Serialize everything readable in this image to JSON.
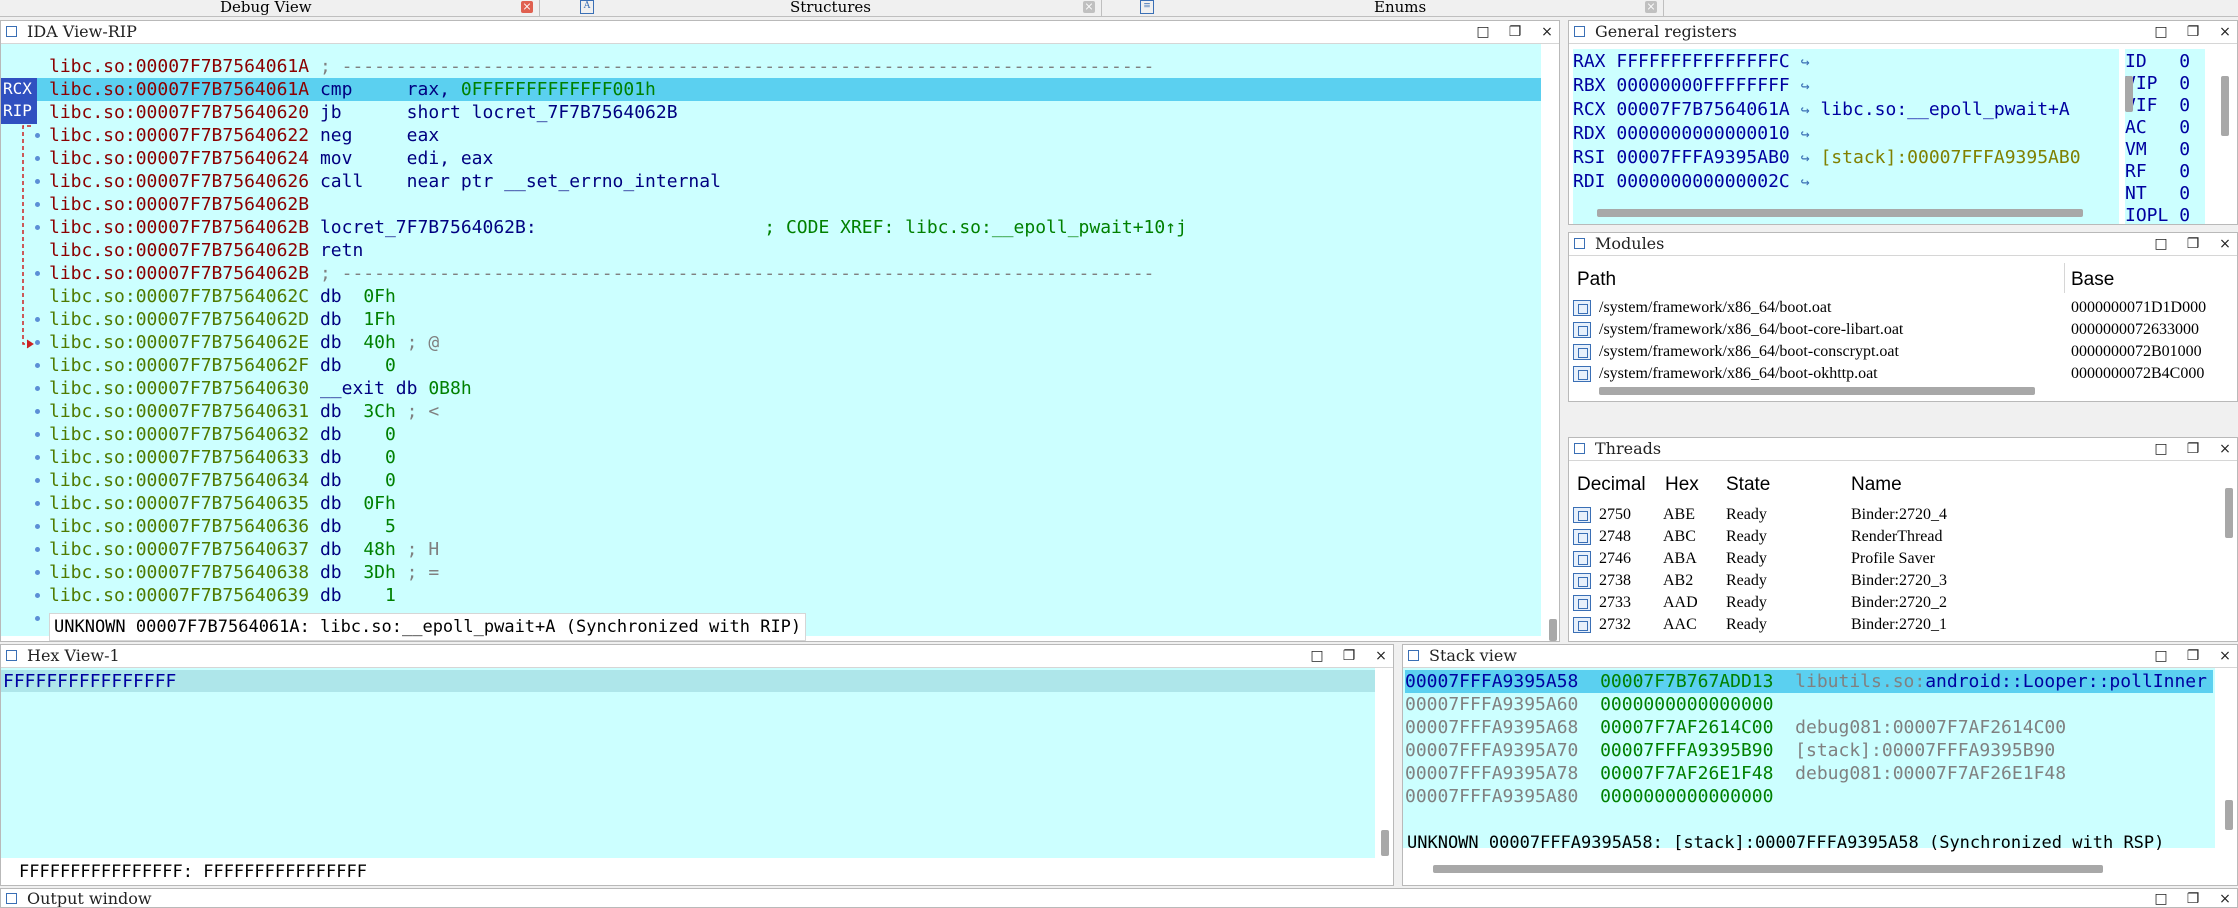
{
  "top_tabs": [
    {
      "label": "Debug View"
    },
    {
      "label": "Structures"
    },
    {
      "label": "Enums"
    }
  ],
  "ida_view": {
    "title": "IDA View-RIP",
    "reg_tags": [
      "RCX",
      "RIP"
    ],
    "lines": [
      {
        "addr": "libc.so:00007F7B7564061A",
        "text": "; ---------------------------------------------------------------------------",
        "kind": "sep",
        "addr_color": "red"
      },
      {
        "addr": "libc.so:00007F7B7564061A",
        "mn": "cmp",
        "ops": "rax, ",
        "num": "0FFFFFFFFFFFFF001h",
        "kind": "ins",
        "addr_color": "red",
        "selected": true
      },
      {
        "addr": "libc.so:00007F7B75640620",
        "mn": "jb",
        "ops": "short locret_7F7B7564062B",
        "kind": "ins",
        "addr_color": "red"
      },
      {
        "addr": "libc.so:00007F7B75640622",
        "mn": "neg",
        "ops": "eax",
        "kind": "ins",
        "addr_color": "red"
      },
      {
        "addr": "libc.so:00007F7B75640624",
        "mn": "mov",
        "ops": "edi, eax",
        "kind": "ins",
        "addr_color": "red"
      },
      {
        "addr": "libc.so:00007F7B75640626",
        "mn": "call",
        "ops": "near ptr __set_errno_internal",
        "kind": "ins",
        "addr_color": "red"
      },
      {
        "addr": "libc.so:00007F7B7564062B",
        "kind": "blank",
        "addr_color": "red"
      },
      {
        "addr": "libc.so:00007F7B7564062B",
        "label": "locret_7F7B7564062B:",
        "xref": "; CODE XREF: libc.so:__epoll_pwait+10↑j",
        "kind": "label",
        "addr_color": "red"
      },
      {
        "addr": "libc.so:00007F7B7564062B",
        "mn": "retn",
        "ops": "",
        "kind": "ins",
        "addr_color": "red"
      },
      {
        "addr": "libc.so:00007F7B7564062B",
        "text": "; ---------------------------------------------------------------------------",
        "kind": "sep",
        "addr_color": "red"
      },
      {
        "addr": "libc.so:00007F7B7564062C",
        "mn": "db",
        "num": "0Fh",
        "pad": "  ",
        "kind": "data",
        "addr_color": "grn"
      },
      {
        "addr": "libc.so:00007F7B7564062D",
        "mn": "db",
        "num": "1Fh",
        "pad": "  ",
        "kind": "data",
        "addr_color": "grn"
      },
      {
        "addr": "libc.so:00007F7B7564062E",
        "mn": "db",
        "num": "40h",
        "pad": "  ",
        "cmt": " ; @",
        "kind": "data",
        "addr_color": "grn"
      },
      {
        "addr": "libc.so:00007F7B7564062F",
        "mn": "db",
        "num": "0",
        "pad": "    ",
        "kind": "data",
        "addr_color": "grn"
      },
      {
        "addr": "libc.so:00007F7B75640630",
        "mn": "__exit db",
        "num": "0B8h",
        "pad": " ",
        "kind": "data",
        "addr_color": "grn"
      },
      {
        "addr": "libc.so:00007F7B75640631",
        "mn": "db",
        "num": "3Ch",
        "pad": "  ",
        "cmt": " ; <",
        "kind": "data",
        "addr_color": "grn"
      },
      {
        "addr": "libc.so:00007F7B75640632",
        "mn": "db",
        "num": "0",
        "pad": "    ",
        "kind": "data",
        "addr_color": "grn"
      },
      {
        "addr": "libc.so:00007F7B75640633",
        "mn": "db",
        "num": "0",
        "pad": "    ",
        "kind": "data",
        "addr_color": "grn"
      },
      {
        "addr": "libc.so:00007F7B75640634",
        "mn": "db",
        "num": "0",
        "pad": "    ",
        "kind": "data",
        "addr_color": "grn"
      },
      {
        "addr": "libc.so:00007F7B75640635",
        "mn": "db",
        "num": "0Fh",
        "pad": "  ",
        "kind": "data",
        "addr_color": "grn"
      },
      {
        "addr": "libc.so:00007F7B75640636",
        "mn": "db",
        "num": "5",
        "pad": "    ",
        "kind": "data",
        "addr_color": "grn"
      },
      {
        "addr": "libc.so:00007F7B75640637",
        "mn": "db",
        "num": "48h",
        "pad": "  ",
        "cmt": " ; H",
        "kind": "data",
        "addr_color": "grn"
      },
      {
        "addr": "libc.so:00007F7B75640638",
        "mn": "db",
        "num": "3Dh",
        "pad": "  ",
        "cmt": " ; =",
        "kind": "data",
        "addr_color": "grn"
      },
      {
        "addr": "libc.so:00007F7B75640639",
        "mn": "db",
        "num": "1",
        "pad": "    ",
        "kind": "data",
        "addr_color": "grn"
      }
    ],
    "status": "UNKNOWN 00007F7B7564061A: libc.so:__epoll_pwait+A (Synchronized with RIP)"
  },
  "general_registers": {
    "title": "General registers",
    "regs": [
      {
        "name": "RAX",
        "value": "FFFFFFFFFFFFFFFC",
        "ref": ""
      },
      {
        "name": "RBX",
        "value": "00000000FFFFFFFF",
        "ref": ""
      },
      {
        "name": "RCX",
        "value": "00007F7B7564061A",
        "ref": "libc.so:__epoll_pwait+A"
      },
      {
        "name": "RDX",
        "value": "0000000000000010",
        "ref": ""
      },
      {
        "name": "RSI",
        "value": "00007FFFA9395AB0",
        "ref": "[stack]:00007FFFA9395AB0"
      },
      {
        "name": "RDI",
        "value": "000000000000002C",
        "ref": ""
      }
    ],
    "flags": [
      {
        "name": "ID",
        "value": "0"
      },
      {
        "name": "VIP",
        "value": "0"
      },
      {
        "name": "VIF",
        "value": "0"
      },
      {
        "name": "AC",
        "value": "0"
      },
      {
        "name": "VM",
        "value": "0"
      },
      {
        "name": "RF",
        "value": "0"
      },
      {
        "name": "NT",
        "value": "0"
      },
      {
        "name": "IOPL",
        "value": "0"
      }
    ]
  },
  "modules": {
    "title": "Modules",
    "headers": [
      "Path",
      "Base"
    ],
    "rows": [
      {
        "path": "/system/framework/x86_64/boot.oat",
        "base": "0000000071D1D000"
      },
      {
        "path": "/system/framework/x86_64/boot-core-libart.oat",
        "base": "0000000072633000"
      },
      {
        "path": "/system/framework/x86_64/boot-conscrypt.oat",
        "base": "0000000072B01000"
      },
      {
        "path": "/system/framework/x86_64/boot-okhttp.oat",
        "base": "0000000072B4C000"
      }
    ]
  },
  "threads": {
    "title": "Threads",
    "headers": [
      "Decimal",
      "Hex",
      "State",
      "Name"
    ],
    "rows": [
      {
        "dec": "2750",
        "hex": "ABE",
        "state": "Ready",
        "name": "Binder:2720_4"
      },
      {
        "dec": "2748",
        "hex": "ABC",
        "state": "Ready",
        "name": "RenderThread"
      },
      {
        "dec": "2746",
        "hex": "ABA",
        "state": "Ready",
        "name": "Profile Saver"
      },
      {
        "dec": "2738",
        "hex": "AB2",
        "state": "Ready",
        "name": "Binder:2720_3"
      },
      {
        "dec": "2733",
        "hex": "AAD",
        "state": "Ready",
        "name": "Binder:2720_2"
      },
      {
        "dec": "2732",
        "hex": "AAC",
        "state": "Ready",
        "name": "Binder:2720_1"
      }
    ]
  },
  "hex_view": {
    "title": "Hex View-1",
    "line": "FFFFFFFFFFFFFFFF",
    "status": "FFFFFFFFFFFFFFFF: FFFFFFFFFFFFFFFF"
  },
  "stack_view": {
    "title": "Stack view",
    "rows": [
      {
        "addr": "00007FFFA9395A58",
        "val": "00007F7B767ADD13",
        "ref_a": "libutils.so:",
        "ref_b": "android::Looper::pollInner",
        "selected": true
      },
      {
        "addr": "00007FFFA9395A60",
        "val": "0000000000000000",
        "ref_a": "",
        "ref_b": ""
      },
      {
        "addr": "00007FFFA9395A68",
        "val": "00007F7AF2614C00",
        "ref_a": "debug081:00007F7AF2614C00",
        "ref_b": ""
      },
      {
        "addr": "00007FFFA9395A70",
        "val": "00007FFFA9395B90",
        "ref_a": "[stack]:00007FFFA9395B90",
        "ref_b": ""
      },
      {
        "addr": "00007FFFA9395A78",
        "val": "00007F7AF26E1F48",
        "ref_a": "debug081:00007F7AF26E1F48",
        "ref_b": ""
      },
      {
        "addr": "00007FFFA9395A80",
        "val": "0000000000000000",
        "ref_a": "",
        "ref_b": ""
      }
    ],
    "status": "UNKNOWN 00007FFFA9395A58: [stack]:00007FFFA9395A58 (Synchronized with RSP)"
  },
  "output_window": {
    "title": "Output window"
  },
  "win_buttons": {
    "min": "□",
    "float": "❐",
    "close": "×"
  }
}
